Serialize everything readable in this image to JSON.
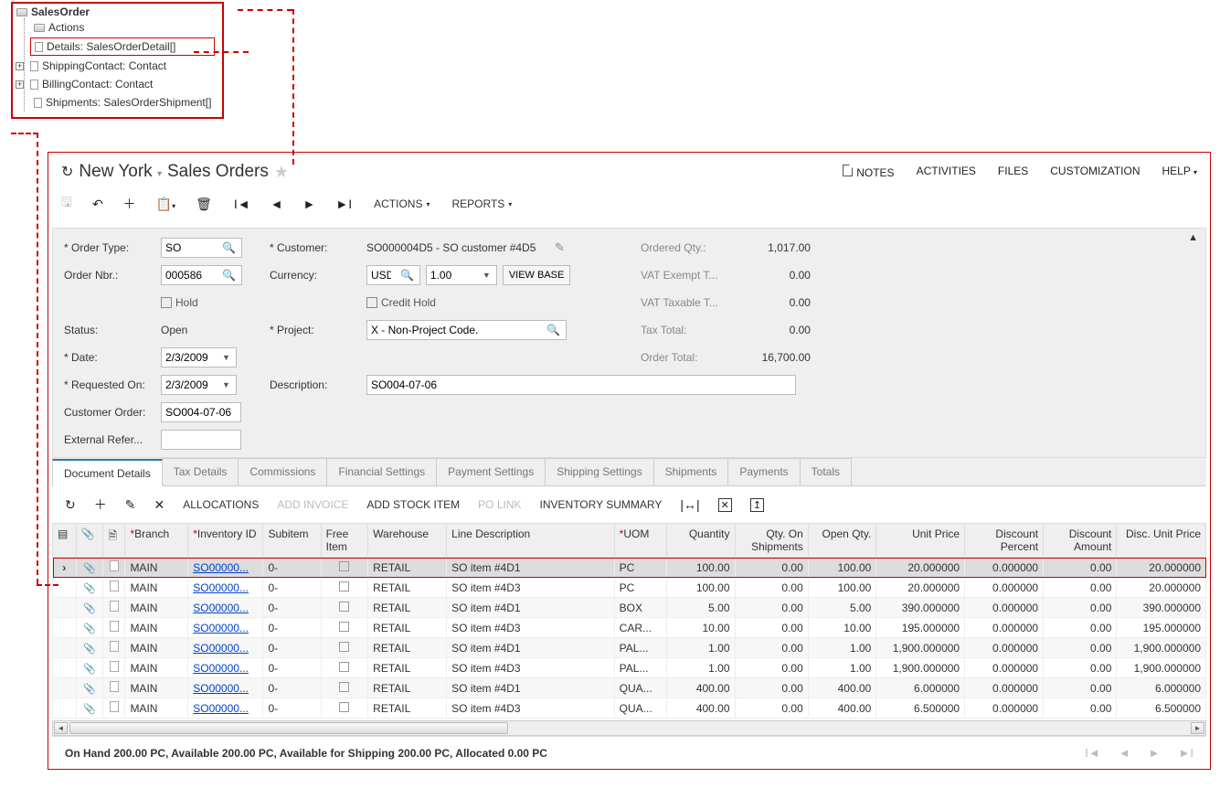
{
  "tree": {
    "root": "SalesOrder",
    "nodes": {
      "actions": "Actions",
      "details": "Details: SalesOrderDetail[]",
      "shipping": "ShippingContact: Contact",
      "billing": "BillingContact: Contact",
      "shipments": "Shipments: SalesOrderShipment[]"
    }
  },
  "header": {
    "company": "New York",
    "screen": "Sales Orders",
    "links": {
      "notes": "NOTES",
      "activities": "ACTIVITIES",
      "files": "FILES",
      "customization": "CUSTOMIZATION",
      "help": "HELP"
    }
  },
  "toolbar": {
    "actions": "ACTIONS",
    "reports": "REPORTS"
  },
  "form": {
    "labels": {
      "orderType": "Order Type:",
      "orderNbr": "Order Nbr.:",
      "hold": "Hold",
      "status": "Status:",
      "date": "Date:",
      "requestedOn": "Requested On:",
      "customerOrder": "Customer Order:",
      "externalRef": "External Refer...",
      "customer": "Customer:",
      "currency": "Currency:",
      "viewBase": "VIEW BASE",
      "creditHold": "Credit Hold",
      "project": "Project:",
      "description": "Description:",
      "orderedQty": "Ordered Qty.:",
      "vatExempt": "VAT Exempt T...",
      "vatTaxable": "VAT Taxable T...",
      "taxTotal": "Tax Total:",
      "orderTotal": "Order Total:"
    },
    "values": {
      "orderType": "SO",
      "orderNbr": "000586",
      "status": "Open",
      "date": "2/3/2009",
      "requestedOn": "2/3/2009",
      "customerOrder": "SO004-07-06",
      "externalRef": "",
      "customer": "SO000004D5 - SO customer #4D5",
      "currency": "USD",
      "rate": "1.00",
      "project": "X - Non-Project Code.",
      "description": "SO004-07-06",
      "orderedQty": "1,017.00",
      "vatExempt": "0.00",
      "vatTaxable": "0.00",
      "taxTotal": "0.00",
      "orderTotal": "16,700.00"
    }
  },
  "tabs": [
    "Document Details",
    "Tax Details",
    "Commissions",
    "Financial Settings",
    "Payment Settings",
    "Shipping Settings",
    "Shipments",
    "Payments",
    "Totals"
  ],
  "gridToolbar": {
    "allocations": "ALLOCATIONS",
    "addInvoice": "ADD INVOICE",
    "addStock": "ADD STOCK ITEM",
    "poLink": "PO LINK",
    "invSummary": "INVENTORY SUMMARY"
  },
  "columns": {
    "branch": "Branch",
    "inventory": "Inventory ID",
    "subitem": "Subitem",
    "freeItem": "Free Item",
    "warehouse": "Warehouse",
    "lineDesc": "Line Description",
    "uom": "UOM",
    "quantity": "Quantity",
    "qtyShip": "Qty. On Shipments",
    "openQty": "Open Qty.",
    "unitPrice": "Unit Price",
    "discPct": "Discount Percent",
    "discAmt": "Discount Amount",
    "discUnit": "Disc. Unit Price"
  },
  "rows": [
    {
      "branch": "MAIN",
      "inv": "SO00000...",
      "sub": "0-",
      "wh": "RETAIL",
      "desc": "SO item #4D1",
      "uom": "PC",
      "qty": "100.00",
      "ship": "0.00",
      "open": "100.00",
      "price": "20.000000",
      "dpct": "0.000000",
      "damt": "0.00",
      "dup": "20.000000"
    },
    {
      "branch": "MAIN",
      "inv": "SO00000...",
      "sub": "0-",
      "wh": "RETAIL",
      "desc": "SO item #4D3",
      "uom": "PC",
      "qty": "100.00",
      "ship": "0.00",
      "open": "100.00",
      "price": "20.000000",
      "dpct": "0.000000",
      "damt": "0.00",
      "dup": "20.000000"
    },
    {
      "branch": "MAIN",
      "inv": "SO00000...",
      "sub": "0-",
      "wh": "RETAIL",
      "desc": "SO item #4D1",
      "uom": "BOX",
      "qty": "5.00",
      "ship": "0.00",
      "open": "5.00",
      "price": "390.000000",
      "dpct": "0.000000",
      "damt": "0.00",
      "dup": "390.000000"
    },
    {
      "branch": "MAIN",
      "inv": "SO00000...",
      "sub": "0-",
      "wh": "RETAIL",
      "desc": "SO item #4D3",
      "uom": "CAR...",
      "qty": "10.00",
      "ship": "0.00",
      "open": "10.00",
      "price": "195.000000",
      "dpct": "0.000000",
      "damt": "0.00",
      "dup": "195.000000"
    },
    {
      "branch": "MAIN",
      "inv": "SO00000...",
      "sub": "0-",
      "wh": "RETAIL",
      "desc": "SO item #4D1",
      "uom": "PAL...",
      "qty": "1.00",
      "ship": "0.00",
      "open": "1.00",
      "price": "1,900.000000",
      "dpct": "0.000000",
      "damt": "0.00",
      "dup": "1,900.000000"
    },
    {
      "branch": "MAIN",
      "inv": "SO00000...",
      "sub": "0-",
      "wh": "RETAIL",
      "desc": "SO item #4D3",
      "uom": "PAL...",
      "qty": "1.00",
      "ship": "0.00",
      "open": "1.00",
      "price": "1,900.000000",
      "dpct": "0.000000",
      "damt": "0.00",
      "dup": "1,900.000000"
    },
    {
      "branch": "MAIN",
      "inv": "SO00000...",
      "sub": "0-",
      "wh": "RETAIL",
      "desc": "SO item #4D1",
      "uom": "QUA...",
      "qty": "400.00",
      "ship": "0.00",
      "open": "400.00",
      "price": "6.000000",
      "dpct": "0.000000",
      "damt": "0.00",
      "dup": "6.000000"
    },
    {
      "branch": "MAIN",
      "inv": "SO00000...",
      "sub": "0-",
      "wh": "RETAIL",
      "desc": "SO item #4D3",
      "uom": "QUA...",
      "qty": "400.00",
      "ship": "0.00",
      "open": "400.00",
      "price": "6.500000",
      "dpct": "0.000000",
      "damt": "0.00",
      "dup": "6.500000"
    }
  ],
  "status": "On Hand 200.00 PC, Available 200.00 PC, Available for Shipping 200.00 PC, Allocated 0.00 PC"
}
